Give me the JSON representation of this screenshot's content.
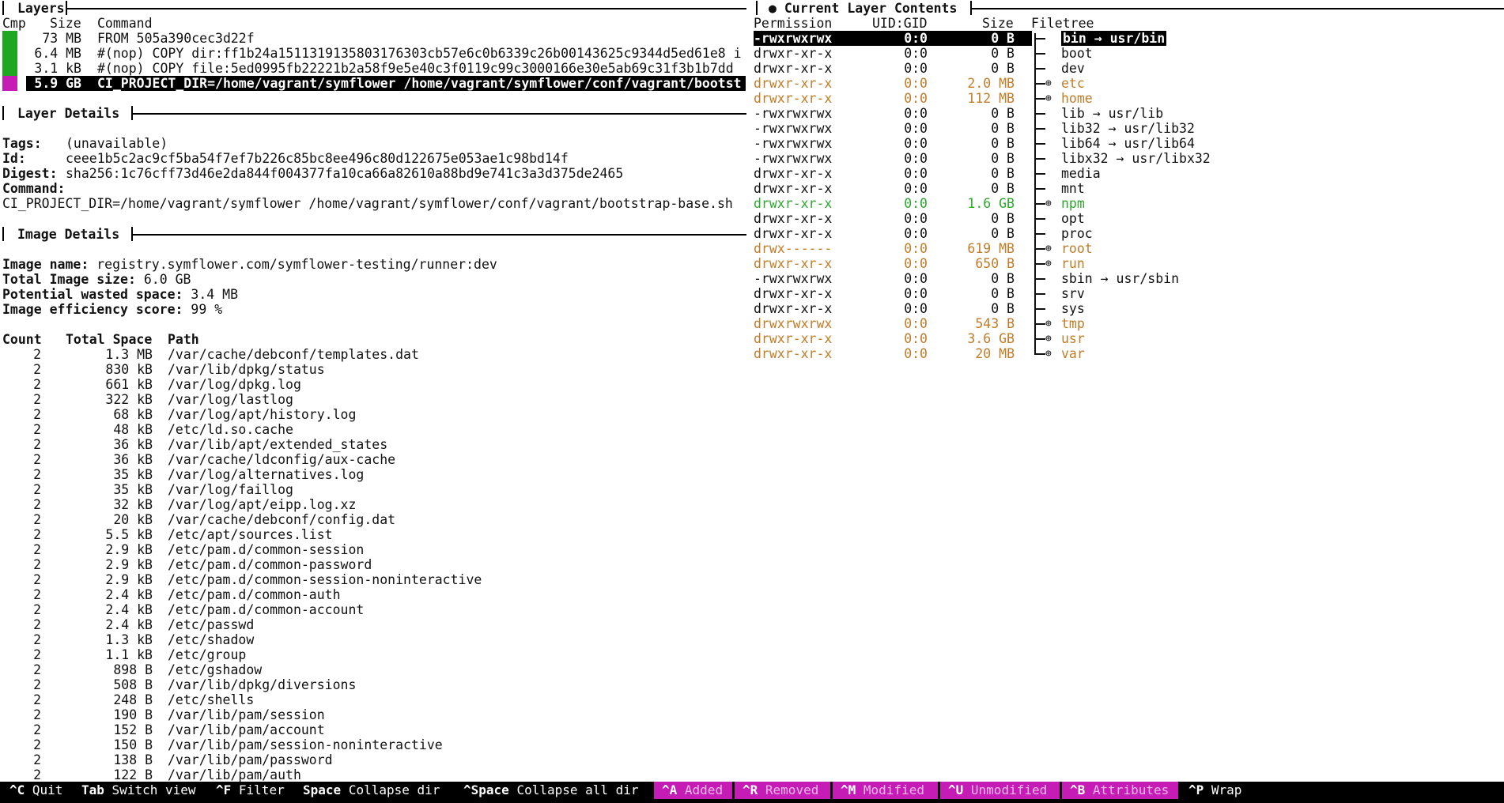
{
  "colors": {
    "added": "#2ea82e",
    "modified": "#c07d2a",
    "layer_green": "#1fa81f",
    "layer_magenta": "#c41cb5"
  },
  "layers": {
    "title": "Layers",
    "headers": {
      "cmp": "Cmp",
      "size": "Size",
      "command": "Command"
    },
    "rows": [
      {
        "size": "73 MB",
        "command": "FROM 505a390cec3d22f",
        "color": "green",
        "selected": false
      },
      {
        "size": "6.4 MB",
        "command": "#(nop) COPY dir:ff1b24a1511319135803176303cb57e6c0b6339c26b00143625c9344d5ed61e8 i",
        "color": "green",
        "selected": false
      },
      {
        "size": "3.1 kB",
        "command": "#(nop) COPY file:5ed0995fb22221b2a58f9e5e40c3f0119c99c3000166e30e5ab69c31f3b1b7dd",
        "color": "green",
        "selected": false
      },
      {
        "size": "5.9 GB",
        "command": "CI_PROJECT_DIR=/home/vagrant/symflower /home/vagrant/symflower/conf/vagrant/bootst",
        "color": "magenta",
        "selected": true
      }
    ]
  },
  "layer_details": {
    "title": "Layer Details",
    "tags_label": "Tags:",
    "tags_value": "(unavailable)",
    "id_label": "Id:",
    "id_value": "ceee1b5c2ac9cf5ba54f7ef7b226c85bc8ee496c80d122675e053ae1c98bd14f",
    "digest_label": "Digest:",
    "digest_value": "sha256:1c76cff73d46e2da844f004377fa10ca66a82610a88bd9e741c3a3d375de2465",
    "command_label": "Command:",
    "command_value": "CI_PROJECT_DIR=/home/vagrant/symflower /home/vagrant/symflower/conf/vagrant/bootstrap-base.sh"
  },
  "image_details": {
    "title": "Image Details",
    "name_label": "Image name:",
    "name_value": "registry.symflower.com/symflower-testing/runner:dev",
    "size_label": "Total Image size:",
    "size_value": "6.0 GB",
    "wasted_label": "Potential wasted space:",
    "wasted_value": "3.4 MB",
    "score_label": "Image efficiency score:",
    "score_value": "99 %",
    "headers": {
      "count": "Count",
      "total": "Total Space",
      "path": "Path"
    },
    "rows": [
      {
        "count": "2",
        "space": "1.3 MB",
        "path": "/var/cache/debconf/templates.dat"
      },
      {
        "count": "2",
        "space": "830 kB",
        "path": "/var/lib/dpkg/status"
      },
      {
        "count": "2",
        "space": "661 kB",
        "path": "/var/log/dpkg.log"
      },
      {
        "count": "2",
        "space": "322 kB",
        "path": "/var/log/lastlog"
      },
      {
        "count": "2",
        "space": "68 kB",
        "path": "/var/log/apt/history.log"
      },
      {
        "count": "2",
        "space": "48 kB",
        "path": "/etc/ld.so.cache"
      },
      {
        "count": "2",
        "space": "36 kB",
        "path": "/var/lib/apt/extended_states"
      },
      {
        "count": "2",
        "space": "36 kB",
        "path": "/var/cache/ldconfig/aux-cache"
      },
      {
        "count": "2",
        "space": "35 kB",
        "path": "/var/log/alternatives.log"
      },
      {
        "count": "2",
        "space": "35 kB",
        "path": "/var/log/faillog"
      },
      {
        "count": "2",
        "space": "32 kB",
        "path": "/var/log/apt/eipp.log.xz"
      },
      {
        "count": "2",
        "space": "20 kB",
        "path": "/var/cache/debconf/config.dat"
      },
      {
        "count": "2",
        "space": "5.5 kB",
        "path": "/etc/apt/sources.list"
      },
      {
        "count": "2",
        "space": "2.9 kB",
        "path": "/etc/pam.d/common-session"
      },
      {
        "count": "2",
        "space": "2.9 kB",
        "path": "/etc/pam.d/common-password"
      },
      {
        "count": "2",
        "space": "2.9 kB",
        "path": "/etc/pam.d/common-session-noninteractive"
      },
      {
        "count": "2",
        "space": "2.4 kB",
        "path": "/etc/pam.d/common-auth"
      },
      {
        "count": "2",
        "space": "2.4 kB",
        "path": "/etc/pam.d/common-account"
      },
      {
        "count": "2",
        "space": "2.4 kB",
        "path": "/etc/passwd"
      },
      {
        "count": "2",
        "space": "1.3 kB",
        "path": "/etc/shadow"
      },
      {
        "count": "2",
        "space": "1.1 kB",
        "path": "/etc/group"
      },
      {
        "count": "2",
        "space": "898 B",
        "path": "/etc/gshadow"
      },
      {
        "count": "2",
        "space": "508 B",
        "path": "/var/lib/dpkg/diversions"
      },
      {
        "count": "2",
        "space": "248 B",
        "path": "/etc/shells"
      },
      {
        "count": "2",
        "space": "190 B",
        "path": "/var/lib/pam/session"
      },
      {
        "count": "2",
        "space": "152 B",
        "path": "/var/lib/pam/account"
      },
      {
        "count": "2",
        "space": "150 B",
        "path": "/var/lib/pam/session-noninteractive"
      },
      {
        "count": "2",
        "space": "138 B",
        "path": "/var/lib/pam/password"
      },
      {
        "count": "2",
        "space": "122 B",
        "path": "/var/lib/pam/auth"
      }
    ]
  },
  "contents": {
    "title": "● Current Layer Contents",
    "headers": {
      "perm": "Permission",
      "uid": "UID:GID",
      "size": "Size",
      "tree": "Filetree"
    },
    "rows": [
      {
        "perm": "-rwxrwxrwx",
        "uid": "0:0",
        "size": "0 B",
        "name": "bin → usr/bin",
        "state": "normal",
        "dir": false,
        "selected": true
      },
      {
        "perm": "drwxr-xr-x",
        "uid": "0:0",
        "size": "0 B",
        "name": "boot",
        "state": "normal",
        "dir": false,
        "selected": false
      },
      {
        "perm": "drwxr-xr-x",
        "uid": "0:0",
        "size": "0 B",
        "name": "dev",
        "state": "normal",
        "dir": false,
        "selected": false
      },
      {
        "perm": "drwxr-xr-x",
        "uid": "0:0",
        "size": "2.0 MB",
        "name": "etc",
        "state": "modified",
        "dir": true,
        "selected": false
      },
      {
        "perm": "drwxr-xr-x",
        "uid": "0:0",
        "size": "112 MB",
        "name": "home",
        "state": "modified",
        "dir": true,
        "selected": false
      },
      {
        "perm": "-rwxrwxrwx",
        "uid": "0:0",
        "size": "0 B",
        "name": "lib → usr/lib",
        "state": "normal",
        "dir": false,
        "selected": false
      },
      {
        "perm": "-rwxrwxrwx",
        "uid": "0:0",
        "size": "0 B",
        "name": "lib32 → usr/lib32",
        "state": "normal",
        "dir": false,
        "selected": false
      },
      {
        "perm": "-rwxrwxrwx",
        "uid": "0:0",
        "size": "0 B",
        "name": "lib64 → usr/lib64",
        "state": "normal",
        "dir": false,
        "selected": false
      },
      {
        "perm": "-rwxrwxrwx",
        "uid": "0:0",
        "size": "0 B",
        "name": "libx32 → usr/libx32",
        "state": "normal",
        "dir": false,
        "selected": false
      },
      {
        "perm": "drwxr-xr-x",
        "uid": "0:0",
        "size": "0 B",
        "name": "media",
        "state": "normal",
        "dir": false,
        "selected": false
      },
      {
        "perm": "drwxr-xr-x",
        "uid": "0:0",
        "size": "0 B",
        "name": "mnt",
        "state": "normal",
        "dir": false,
        "selected": false
      },
      {
        "perm": "drwxr-xr-x",
        "uid": "0:0",
        "size": "1.6 GB",
        "name": "npm",
        "state": "added",
        "dir": true,
        "selected": false
      },
      {
        "perm": "drwxr-xr-x",
        "uid": "0:0",
        "size": "0 B",
        "name": "opt",
        "state": "normal",
        "dir": false,
        "selected": false
      },
      {
        "perm": "drwxr-xr-x",
        "uid": "0:0",
        "size": "0 B",
        "name": "proc",
        "state": "normal",
        "dir": false,
        "selected": false
      },
      {
        "perm": "drwx------",
        "uid": "0:0",
        "size": "619 MB",
        "name": "root",
        "state": "modified",
        "dir": true,
        "selected": false
      },
      {
        "perm": "drwxr-xr-x",
        "uid": "0:0",
        "size": "650 B",
        "name": "run",
        "state": "modified",
        "dir": true,
        "selected": false
      },
      {
        "perm": "-rwxrwxrwx",
        "uid": "0:0",
        "size": "0 B",
        "name": "sbin → usr/sbin",
        "state": "normal",
        "dir": false,
        "selected": false
      },
      {
        "perm": "drwxr-xr-x",
        "uid": "0:0",
        "size": "0 B",
        "name": "srv",
        "state": "normal",
        "dir": false,
        "selected": false
      },
      {
        "perm": "drwxr-xr-x",
        "uid": "0:0",
        "size": "0 B",
        "name": "sys",
        "state": "normal",
        "dir": false,
        "selected": false
      },
      {
        "perm": "drwxrwxrwx",
        "uid": "0:0",
        "size": "543 B",
        "name": "tmp",
        "state": "modified",
        "dir": true,
        "selected": false
      },
      {
        "perm": "drwxr-xr-x",
        "uid": "0:0",
        "size": "3.6 GB",
        "name": "usr",
        "state": "modified",
        "dir": true,
        "selected": false
      },
      {
        "perm": "drwxr-xr-x",
        "uid": "0:0",
        "size": "20 MB",
        "name": "var",
        "state": "modified",
        "dir": true,
        "selected": false
      }
    ]
  },
  "footer": [
    {
      "key": "^C",
      "label": "Quit",
      "style": "plain"
    },
    {
      "key": "Tab",
      "label": "Switch view",
      "style": "plain"
    },
    {
      "key": "^F",
      "label": "Filter",
      "style": "plain"
    },
    {
      "key": "Space",
      "label": "Collapse dir",
      "style": "plain"
    },
    {
      "key": "^Space",
      "label": "Collapse all dir",
      "style": "plain"
    },
    {
      "key": "^A",
      "label": "Added",
      "style": "mod"
    },
    {
      "key": "^R",
      "label": "Removed",
      "style": "mod"
    },
    {
      "key": "^M",
      "label": "Modified",
      "style": "mod"
    },
    {
      "key": "^U",
      "label": "Unmodified",
      "style": "mod"
    },
    {
      "key": "^B",
      "label": "Attributes",
      "style": "mod"
    },
    {
      "key": "^P",
      "label": "Wrap",
      "style": "plain"
    }
  ]
}
